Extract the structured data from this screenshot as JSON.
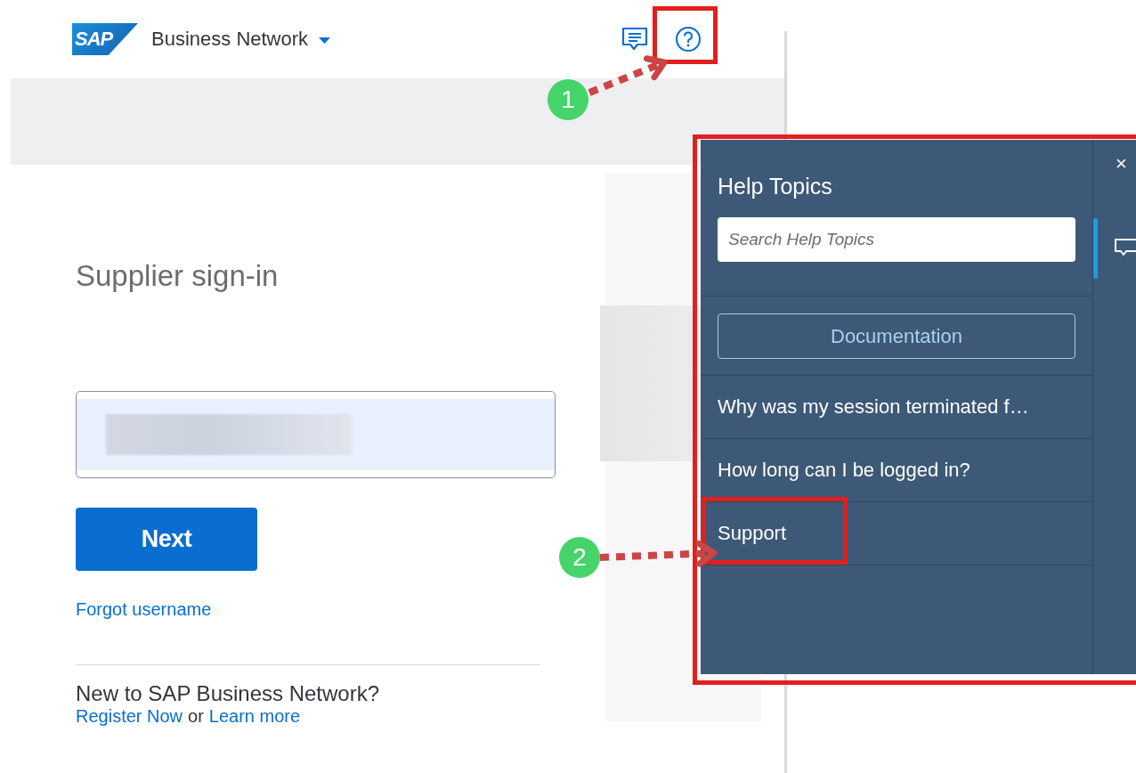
{
  "header": {
    "logo": "SAP",
    "product": "Business Network"
  },
  "signin": {
    "title": "Supplier sign-in",
    "next_button": "Next",
    "forgot_link": "Forgot username",
    "new_heading": "New to SAP Business Network?",
    "register_link": "Register Now",
    "or": "or",
    "learn_link": "Learn more"
  },
  "help_panel": {
    "title": "Help Topics",
    "search": {
      "placeholder": "Search Help Topics"
    },
    "documentation_button": "Documentation",
    "close": "×",
    "topics": [
      {
        "label": "Why was my session terminated f…"
      },
      {
        "label": "How long can I be logged in?"
      },
      {
        "label": "Support"
      }
    ]
  },
  "annotations": [
    {
      "number": "1"
    },
    {
      "number": "2"
    }
  ]
}
